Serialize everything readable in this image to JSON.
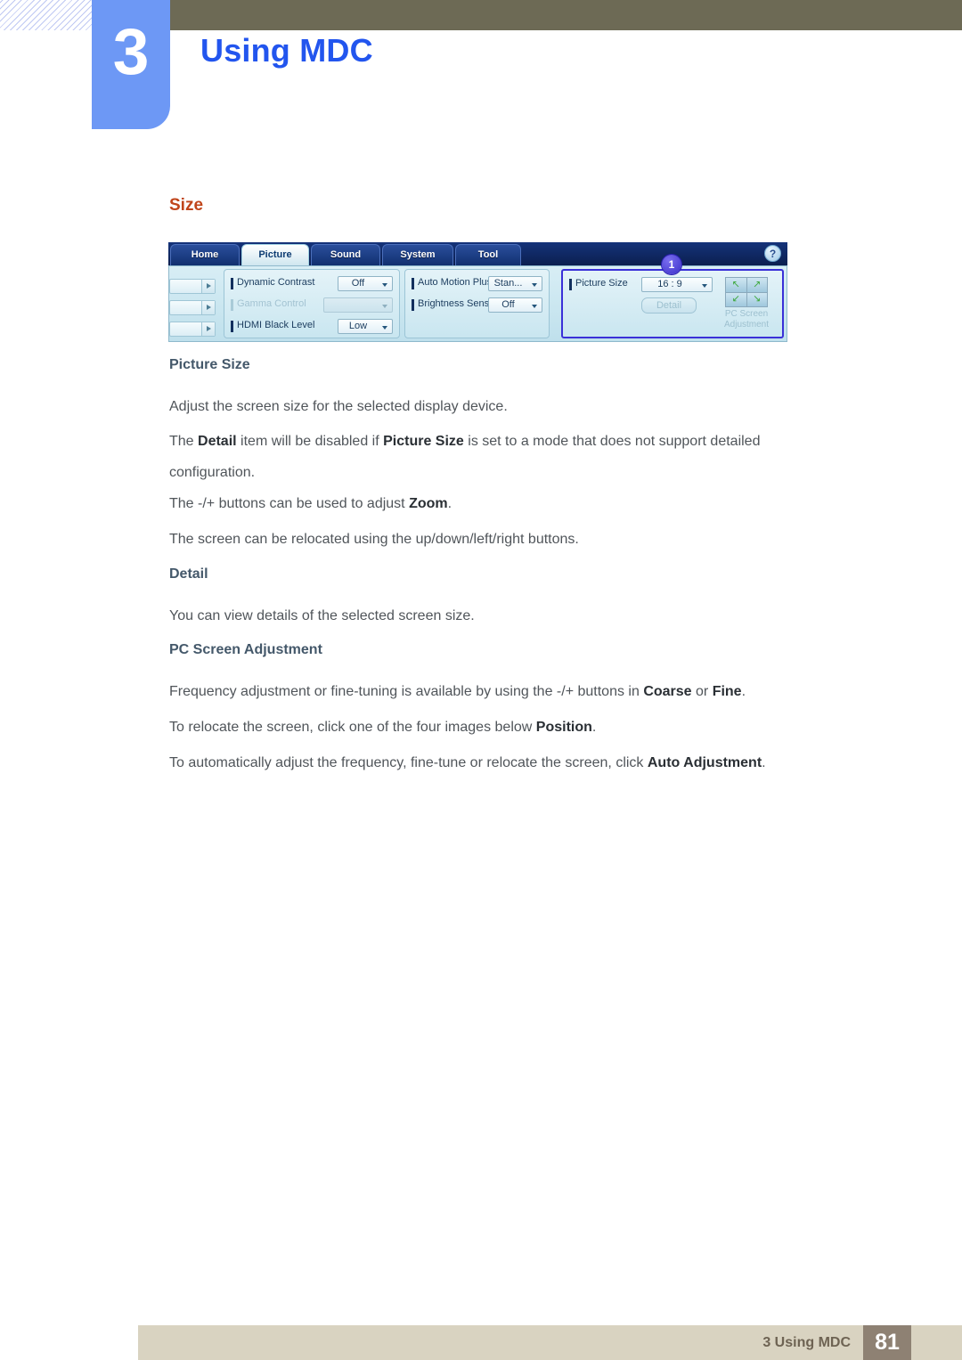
{
  "chapter": {
    "number": "3",
    "title": "Using MDC"
  },
  "section": {
    "heading": "Size"
  },
  "mdc_screenshot": {
    "tabs": [
      {
        "label": "Home",
        "active": false
      },
      {
        "label": "Picture",
        "active": true
      },
      {
        "label": "Sound",
        "active": false
      },
      {
        "label": "System",
        "active": false
      },
      {
        "label": "Tool",
        "active": false
      }
    ],
    "help_icon": "?",
    "callout_badge": "1",
    "panel_left": {
      "rows": [
        {
          "label": "Dynamic Contrast",
          "value": "Off",
          "disabled": false
        },
        {
          "label": "Gamma Control",
          "value": "",
          "disabled": true
        },
        {
          "label": "HDMI Black Level",
          "value": "Low",
          "disabled": false
        }
      ]
    },
    "panel_middle": {
      "rows": [
        {
          "label": "Auto Motion Plus",
          "value": "Stan...",
          "disabled": false
        },
        {
          "label": "Brightness Sensor",
          "value": "Off",
          "disabled": false
        }
      ]
    },
    "panel_right": {
      "rows": [
        {
          "label": "Picture Size",
          "value": "16 : 9",
          "disabled": false
        }
      ],
      "detail_button": "Detail",
      "pc_screen_adjustment_label_line1": "PC Screen",
      "pc_screen_adjustment_label_line2": "Adjustment"
    }
  },
  "content": {
    "h1": "Picture Size",
    "p1": "Adjust the screen size for the selected display device.",
    "p2_a": "The ",
    "p2_b1": "Detail",
    "p2_b": " item will be disabled if ",
    "p2_b2": "Picture Size",
    "p2_c": " is set to a mode that does not support detailed configuration.",
    "p3_a": "The -/+ buttons can be used to adjust ",
    "p3_b": "Zoom",
    "p3_c": ".",
    "p4": "The screen can be relocated using the up/down/left/right buttons.",
    "h2": "Detail",
    "p5": "You can view details of the selected screen size.",
    "h3": "PC Screen Adjustment",
    "p6_a": "Frequency adjustment or fine-tuning is available by using the -/+ buttons in ",
    "p6_b1": "Coarse",
    "p6_b": " or ",
    "p6_b2": "Fine",
    "p6_c": ".",
    "p7_a": "To relocate the screen, click one of the four images below ",
    "p7_b": "Position",
    "p7_c": ".",
    "p8_a": "To automatically adjust the frequency, fine-tune or relocate the screen, click ",
    "p8_b": "Auto Adjustment",
    "p8_c": "."
  },
  "footer": {
    "text": "3 Using MDC",
    "page": "81"
  },
  "colors": {
    "header_bar": "#6d6a55",
    "chapter_block": "#6d98f5",
    "chapter_title": "#2255ee",
    "section_heading": "#c0451b",
    "sub_heading": "#44586a",
    "body_text": "#50555a",
    "footer_bar": "#d9d3c1",
    "footer_page": "#8e8173",
    "callout_badge": "#3a2fc8"
  }
}
